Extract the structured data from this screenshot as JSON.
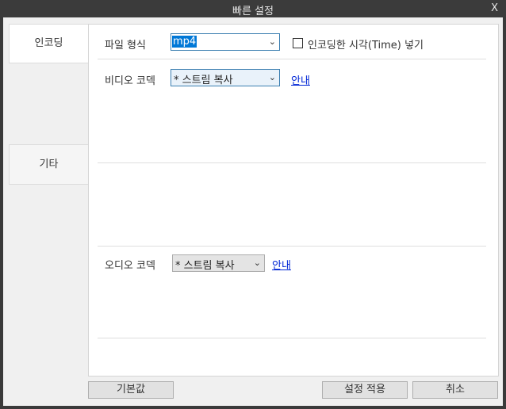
{
  "window": {
    "title": "빠른 설정",
    "close_label": "X"
  },
  "tabs": [
    {
      "label": "인코딩",
      "active": true
    },
    {
      "label": "기타",
      "active": false
    }
  ],
  "encoding": {
    "file_format": {
      "label": "파일 형식",
      "value": "mp4"
    },
    "insert_time": {
      "label": "인코딩한 시각(Time) 넣기",
      "checked": false
    },
    "video_codec": {
      "label": "비디오 코덱",
      "value": "* 스트림 복사",
      "guide_label": "안내"
    },
    "audio_codec": {
      "label": "오디오 코덱",
      "value": "* 스트림 복사",
      "guide_label": "안내"
    }
  },
  "buttons": {
    "default_label": "기본값",
    "apply_label": "설정 적용",
    "cancel_label": "취소"
  },
  "icons": {
    "dropdown": "chevron-down-icon"
  }
}
